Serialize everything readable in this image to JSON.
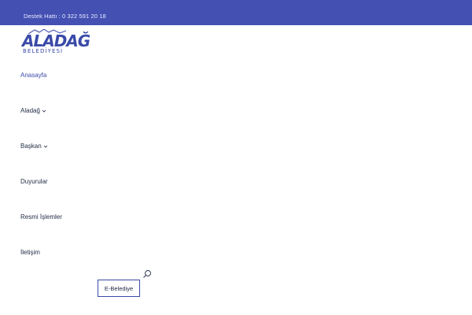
{
  "topbar": {
    "support_text": "Destek Hattı : 0 322 591 20 18",
    "background": "#4451b3"
  },
  "logo": {
    "main_text": "ALADAĞ",
    "sub_text": "BELEDİYESİ",
    "color": "#3a4aa8"
  },
  "nav": {
    "items": [
      {
        "label": "Anasayfa",
        "has_dropdown": false,
        "active": true
      },
      {
        "label": "Aladağ",
        "has_dropdown": true,
        "active": false
      },
      {
        "label": "Başkan",
        "has_dropdown": true,
        "active": false
      },
      {
        "label": "Duyurular",
        "has_dropdown": false,
        "active": false
      },
      {
        "label": "Resmi İşlemler",
        "has_dropdown": false,
        "active": false
      },
      {
        "label": "İletişim",
        "has_dropdown": false,
        "active": false
      }
    ]
  },
  "search": {
    "icon": "search-icon"
  },
  "ebelediye": {
    "label": "E-Belediye"
  },
  "colors": {
    "accent": "#3a4aa8",
    "text": "#1f2a44"
  }
}
